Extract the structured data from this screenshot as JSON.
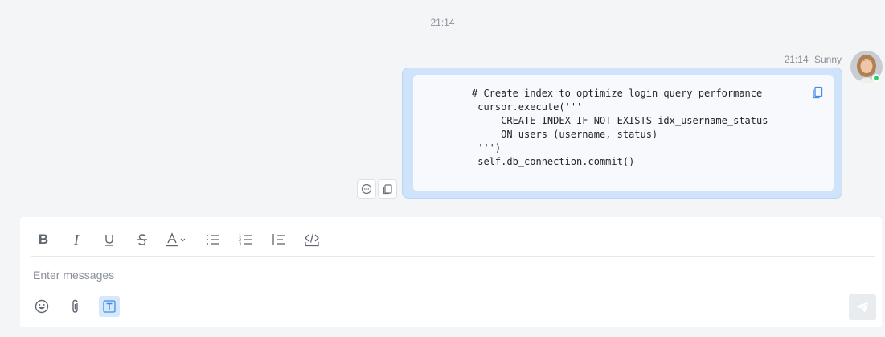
{
  "chat": {
    "time_divider": "21:14",
    "message": {
      "time": "21:14",
      "sender": "Sunny",
      "code_lines": [
        "# Create index to optimize login query performance",
        " cursor.execute('''",
        "     CREATE INDEX IF NOT EXISTS idx_username_status",
        "     ON users (username, status)",
        " ''')",
        " self.db_connection.commit()"
      ],
      "status": "online"
    }
  },
  "toolbar": {
    "bold": "B",
    "italic": "I",
    "items": [
      "bold-icon",
      "italic-icon",
      "underline-icon",
      "strikethrough-icon",
      "font-color-icon",
      "bulleted-list-icon",
      "numbered-list-icon",
      "quote-icon",
      "code-block-icon"
    ]
  },
  "composer": {
    "placeholder": "Enter messages",
    "bottom_items": [
      "emoji-icon",
      "attachment-icon",
      "text-format-icon"
    ]
  },
  "colors": {
    "bubble": "#cfe3fa",
    "accent": "#4a90e2",
    "online": "#2ecc71"
  }
}
